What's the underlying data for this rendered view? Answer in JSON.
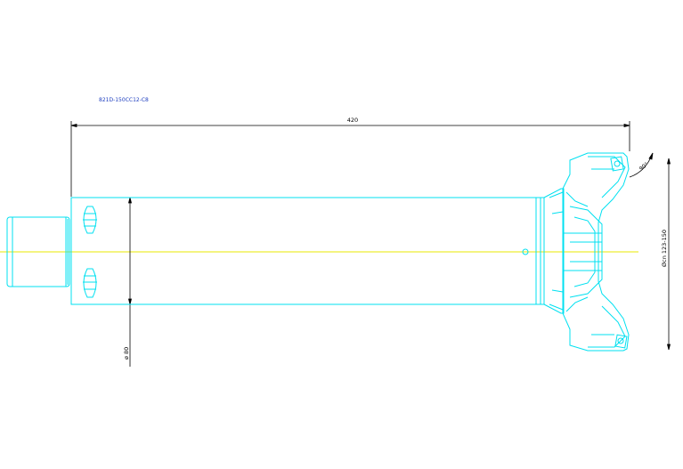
{
  "drawing": {
    "part_number": "821D-150CC12-C8",
    "overall_length": "420",
    "shank_diameter": "ø 80",
    "cutting_diameter": "Øcn 123-150",
    "lead_angle": "90°"
  },
  "colors": {
    "outline": "#00e0f0",
    "centerline": "#e8e800",
    "dimension": "#000000",
    "title": "#2040c0"
  }
}
